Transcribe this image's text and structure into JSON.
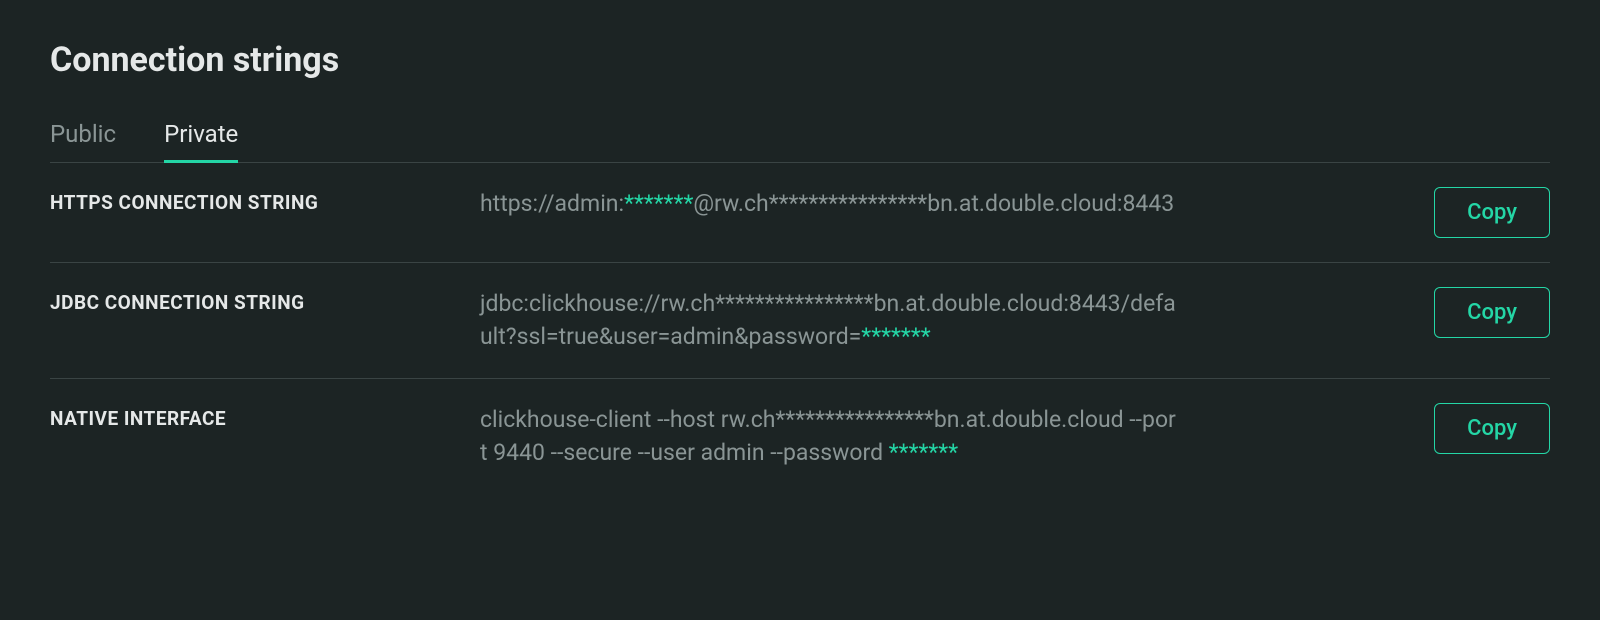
{
  "title": "Connection strings",
  "tabs": {
    "public": {
      "label": "Public",
      "active": false
    },
    "private": {
      "label": "Private",
      "active": true
    }
  },
  "rows": {
    "https": {
      "label": "HTTPS CONNECTION STRING",
      "segments": [
        {
          "text": "https://admin:",
          "masked": false
        },
        {
          "text": "*******",
          "masked": true
        },
        {
          "text": "@rw.ch****************bn.at.double.cloud:8443",
          "masked": false
        }
      ],
      "copy_label": "Copy"
    },
    "jdbc": {
      "label": "JDBC CONNECTION STRING",
      "segments": [
        {
          "text": "jdbc:clickhouse://rw.ch****************bn.at.double.cloud:8443/default?ssl=true&user=admin&password=",
          "masked": false
        },
        {
          "text": "*******",
          "masked": true
        }
      ],
      "copy_label": "Copy"
    },
    "native": {
      "label": "NATIVE INTERFACE",
      "segments": [
        {
          "text": "clickhouse-client --host rw.ch****************bn.at.double.cloud --port 9440 --secure --user admin --password ",
          "masked": false
        },
        {
          "text": "*******",
          "masked": true
        }
      ],
      "copy_label": "Copy"
    }
  }
}
